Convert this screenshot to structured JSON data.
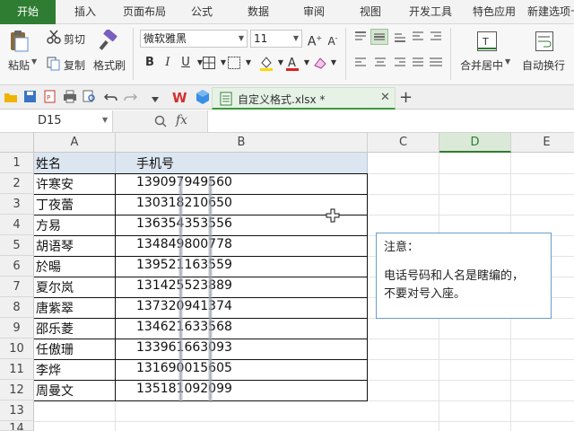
{
  "menu": {
    "tabs": [
      "开始",
      "插入",
      "页面布局",
      "公式",
      "数据",
      "审阅",
      "视图",
      "开发工具",
      "特色应用",
      "新建选项卡"
    ],
    "active_index": 0
  },
  "ribbon": {
    "paste": "粘贴",
    "cut": "剪切",
    "copy": "复制",
    "format_painter": "格式刷",
    "font_name": "微软雅黑",
    "font_size": "11",
    "merge_center": "合并居中",
    "wrap_text": "自动换行"
  },
  "doc": {
    "tab_title": "自定义格式.xlsx *"
  },
  "formula": {
    "name_box": "D15",
    "fx": "fx"
  },
  "sheet": {
    "columns": [
      "A",
      "B",
      "C",
      "D",
      "E"
    ],
    "selected_column": "D",
    "rows": [
      "1",
      "2",
      "3",
      "4",
      "5",
      "6",
      "7",
      "8",
      "9",
      "10",
      "11",
      "12",
      "13",
      "14"
    ],
    "header": [
      "姓名",
      "手机号"
    ],
    "data": [
      [
        "许寒安",
        "139097949560"
      ],
      [
        "丁夜蕾",
        "130318210650"
      ],
      [
        "方易",
        "136354353556"
      ],
      [
        "胡语琴",
        "134849800778"
      ],
      [
        "於暘",
        "139521163559"
      ],
      [
        "夏尔岚",
        "131425523889"
      ],
      [
        "唐紫翠",
        "137320941374"
      ],
      [
        "邵乐菱",
        "134621633568"
      ],
      [
        "任傲珊",
        "133961663093"
      ],
      [
        "李烨",
        "131690015605"
      ],
      [
        "周曼文",
        "135181092099"
      ]
    ],
    "header_fill": "#dce6f1"
  },
  "note": {
    "lines": [
      "注意：",
      "",
      "电话号码和人名是瞎编的，",
      "不要对号入座。"
    ]
  },
  "colors": {
    "accent": "#2e7d32",
    "note_border": "#6a9ccf"
  }
}
